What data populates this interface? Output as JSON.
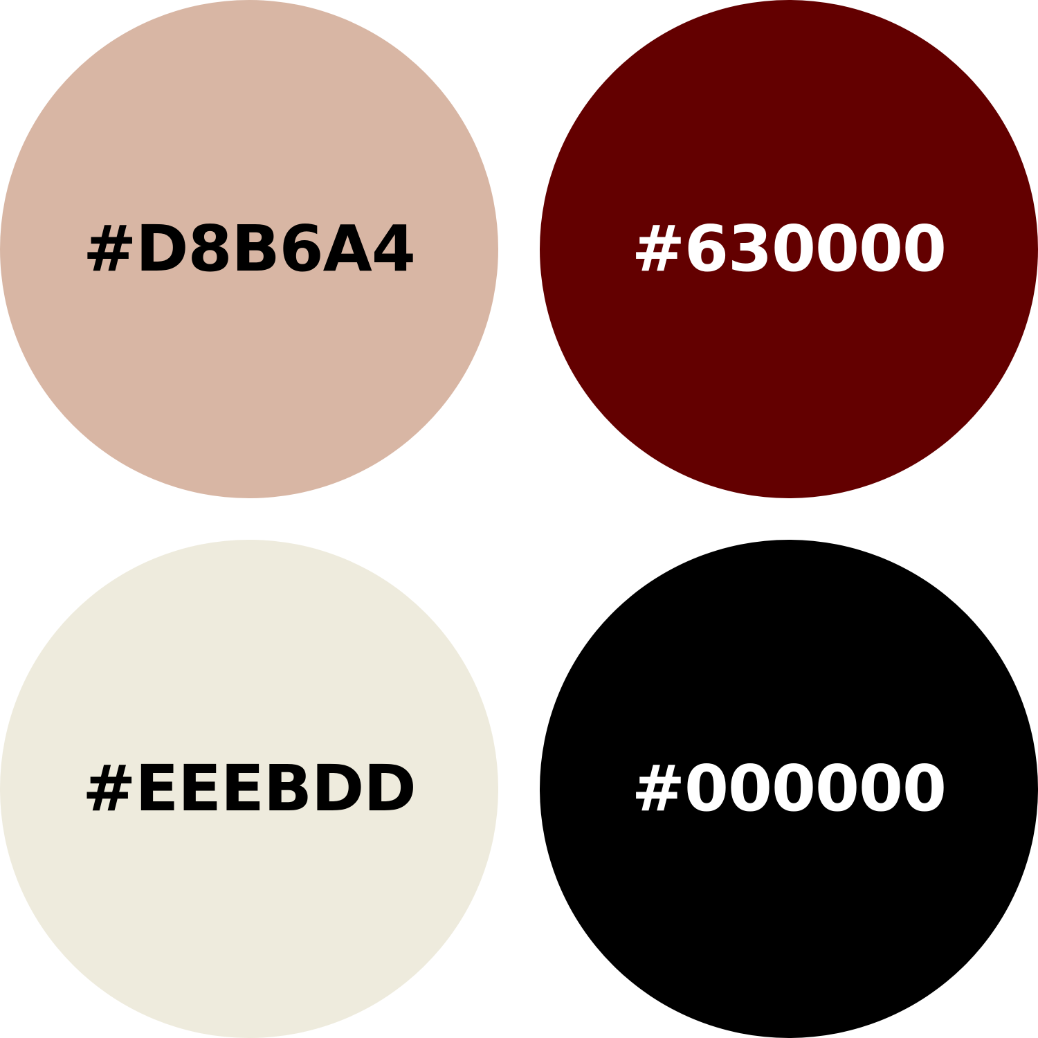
{
  "swatches": [
    {
      "label": "#D8B6A4",
      "color": "#D8B6A4",
      "text_color": "#000000"
    },
    {
      "label": "#630000",
      "color": "#630000",
      "text_color": "#FFFFFF"
    },
    {
      "label": "#EEEBDD",
      "color": "#EEEBDD",
      "text_color": "#000000"
    },
    {
      "label": "#000000",
      "color": "#000000",
      "text_color": "#FFFFFF"
    }
  ]
}
